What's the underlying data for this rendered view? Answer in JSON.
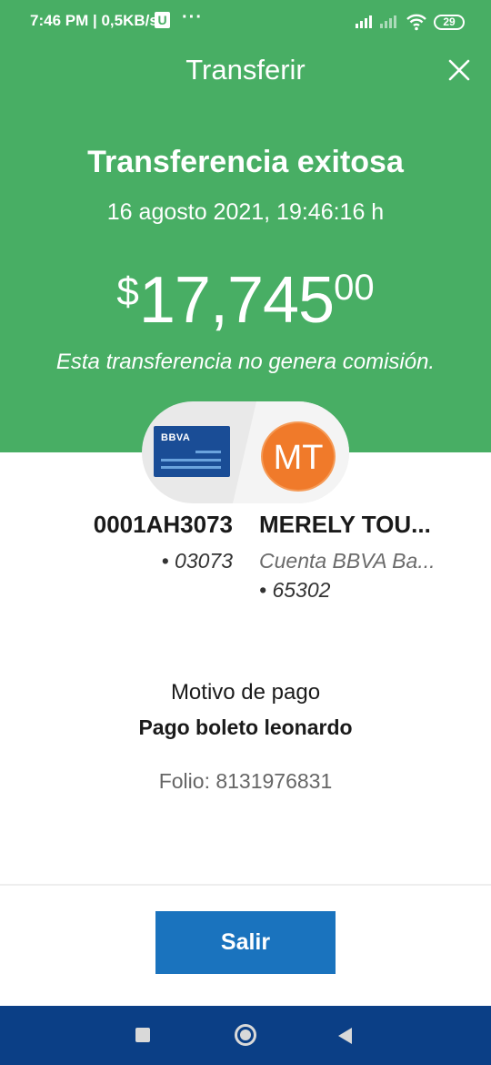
{
  "status_bar": {
    "time_net": "7:46 PM | 0,5KB/s",
    "u_badge": "U",
    "dots": "···",
    "battery": "29"
  },
  "header": {
    "title": "Transferir",
    "close_icon": "close-icon"
  },
  "result": {
    "title": "Transferencia exitosa",
    "date": "16 agosto 2021, 19:46:16 h",
    "amount_currency": "$",
    "amount_main": "17,745",
    "amount_cents": "00",
    "commission_note": "Esta transferencia no genera comisión."
  },
  "transfer": {
    "from_card_logo": "BBVA",
    "to_initials": "MT",
    "from_name": "0001AH3073",
    "from_number": "• 03073",
    "to_name": "MERELY TOU...",
    "to_type": "Cuenta BBVA Ba...",
    "to_number": "• 65302"
  },
  "details": {
    "motive_label": "Motivo de pago",
    "motive_value": "Pago boleto leonardo",
    "folio": "Folio: 8131976831"
  },
  "actions": {
    "exit_label": "Salir"
  },
  "colors": {
    "success_green": "#48ae64",
    "button_blue": "#1a73be",
    "nav_blue": "#0b3f86",
    "avatar_orange": "#f07a2a",
    "bbva_card": "#1a4d96"
  }
}
